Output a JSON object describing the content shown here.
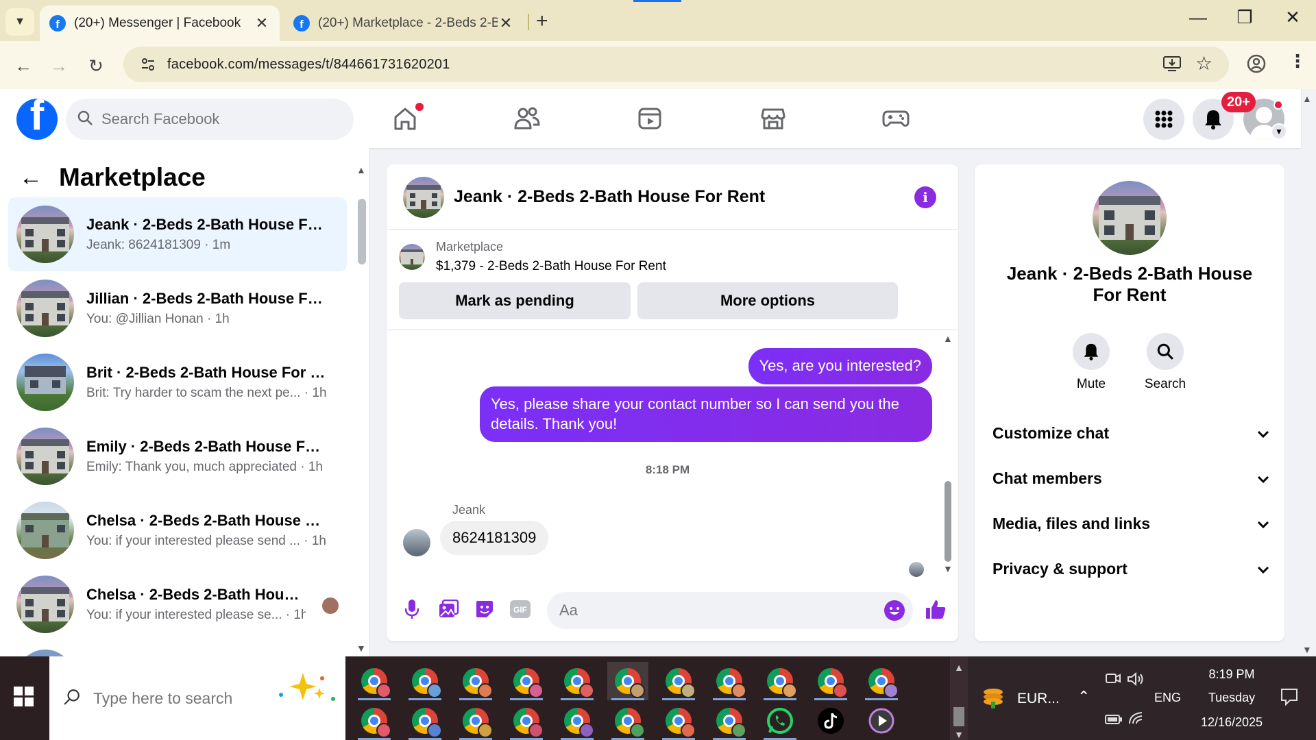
{
  "browser": {
    "tabs": [
      {
        "title": "(20+) Messenger | Facebook",
        "active": true
      },
      {
        "title": "(20+) Marketplace - 2-Beds 2-B",
        "active": false
      }
    ],
    "url": "facebook.com/messages/t/844661731620201"
  },
  "fb": {
    "search_placeholder": "Search Facebook",
    "notif_badge": "20+"
  },
  "left": {
    "title": "Marketplace",
    "conversations": [
      {
        "name": "Jeank · 2-Beds 2-Bath House For...",
        "preview": "Jeank: 8624181309 · 1m",
        "thumb": "house"
      },
      {
        "name": "Jillian · 2-Beds 2-Bath House For...",
        "preview": "You: @Jillian Honan · 1h",
        "thumb": "house"
      },
      {
        "name": "Brit · 2-Beds 2-Bath House For R...",
        "preview": "Brit: Try harder to scam the next pe... · 1h",
        "thumb": "house-blue"
      },
      {
        "name": "Emily · 2-Beds 2-Bath House For...",
        "preview": "Emily: Thank you, much appreciated · 1h",
        "thumb": "house"
      },
      {
        "name": "Chelsa · 2-Beds 2-Bath House Fo...",
        "preview": "You: if your interested please send ... · 1h",
        "thumb": "house-green"
      },
      {
        "name": "Chelsa · 2-Beds 2-Bath House ...",
        "preview": "You: if your interested please se... · 1h",
        "thumb": "house"
      }
    ]
  },
  "chat": {
    "title": "Jeank · 2-Beds 2-Bath House For Rent",
    "marketplace_label": "Marketplace",
    "listing": "$1,379 - 2-Beds 2-Bath House For Rent",
    "btn_pending": "Mark as pending",
    "btn_more": "More options",
    "messages_out": [
      "Yes, are you interested?",
      "Yes, please share your contact number so I can send you the details. Thank you!"
    ],
    "timestamp": "8:18 PM",
    "sender": "Jeank",
    "message_in": "8624181309",
    "composer_placeholder": "Aa"
  },
  "info": {
    "title": "Jeank · 2-Beds 2-Bath House For Rent",
    "mute_label": "Mute",
    "search_label": "Search",
    "sections": [
      "Customize chat",
      "Chat members",
      "Media, files and links",
      "Privacy & support"
    ]
  },
  "taskbar": {
    "search_placeholder": "Type here to search",
    "currency": "EUR...",
    "lang": "ENG",
    "time": "8:19 PM",
    "day": "Tuesday",
    "date": "12/16/2025"
  }
}
